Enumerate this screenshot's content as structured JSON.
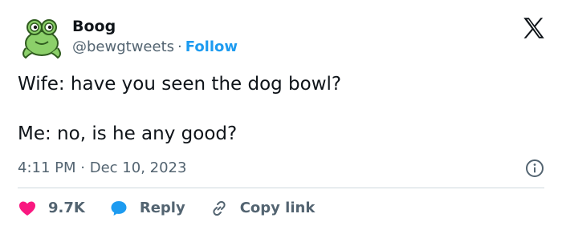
{
  "author": {
    "display_name": "Boog",
    "handle": "@bewgtweets",
    "separator": "·",
    "follow_label": "Follow",
    "avatar_icon": "frog-avatar-icon"
  },
  "platform_icon": "x-logo-icon",
  "tweet": {
    "text": "Wife: have you seen the dog bowl?\n\nMe: no, is he any good?",
    "time": "4:11 PM",
    "separator": "·",
    "date": "Dec 10, 2023"
  },
  "actions": {
    "like_count": "9.7K",
    "reply_label": "Reply",
    "copy_label": "Copy link"
  },
  "colors": {
    "accent": "#1d9bf0",
    "like": "#f91880",
    "text": "#0f1419",
    "muted": "#536471"
  }
}
